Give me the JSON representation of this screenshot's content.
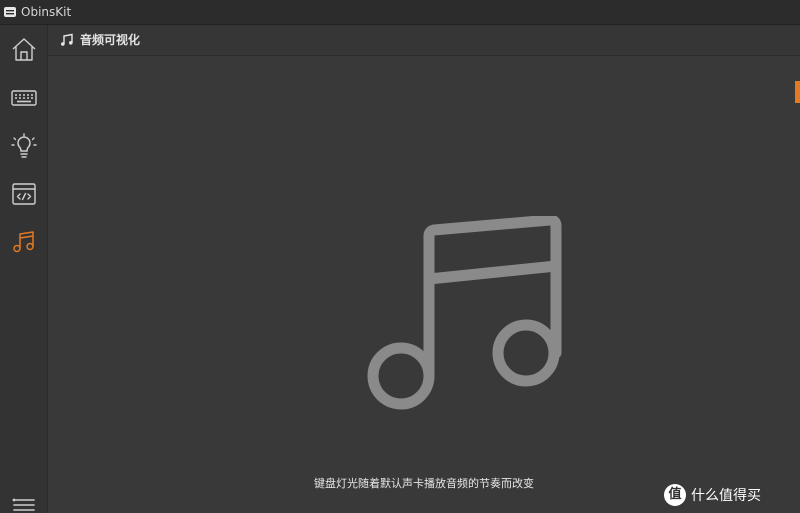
{
  "window": {
    "title": "ObinsKit"
  },
  "sidebar": {
    "items": [
      {
        "name": "home",
        "icon": "home-icon",
        "active": false
      },
      {
        "name": "keyboard",
        "icon": "keyboard-icon",
        "active": false
      },
      {
        "name": "lighting",
        "icon": "lightbulb-icon",
        "active": false
      },
      {
        "name": "macro",
        "icon": "code-window-icon",
        "active": false
      },
      {
        "name": "music",
        "icon": "music-note-icon",
        "active": true
      }
    ],
    "bottom_icon": "list-icon"
  },
  "header": {
    "title": "音频可视化",
    "icon": "music-note-icon"
  },
  "main": {
    "icon": "music-note-icon",
    "description": "键盘灯光随着默认声卡播放音频的节奏而改变"
  },
  "watermark": {
    "badge": "值",
    "text": "什么值得买"
  },
  "colors": {
    "accent": "#e17a24",
    "background": "#393939",
    "sidebar": "#333333",
    "titlebar": "#2c2c2c",
    "icon_gray": "#cfcfcf",
    "big_icon_gray": "#8a8a8a"
  }
}
